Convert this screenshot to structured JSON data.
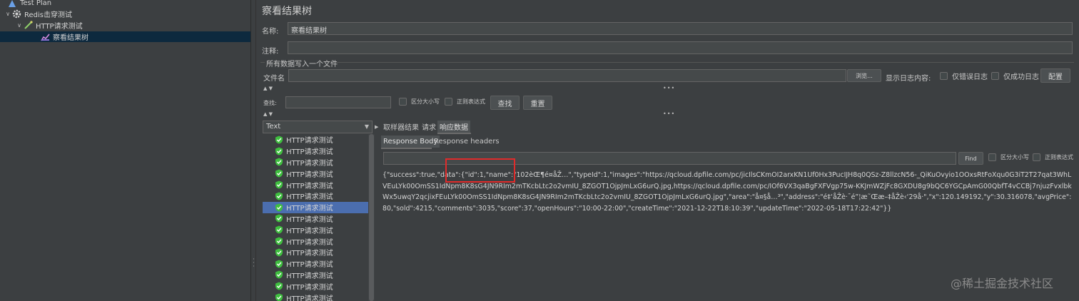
{
  "tree": {
    "items": [
      {
        "label": "Test Plan"
      },
      {
        "label": "Redis击穿测试"
      },
      {
        "label": "HTTP请求测试"
      },
      {
        "label": "察看结果树"
      }
    ]
  },
  "panel": {
    "title": "察看结果树",
    "name_label": "名称:",
    "name_value": "察看结果树",
    "comment_label": "注释:",
    "comment_value": "",
    "section_title": "所有数据写入一个文件",
    "filename_label": "文件名",
    "filename_value": "",
    "browse_label": "浏览...",
    "log_label": "显示日志内容:",
    "errors_only": "仅错误日志",
    "success_only": "仅成功日志",
    "configure_label": "配置"
  },
  "search": {
    "label": "查找:",
    "value": "",
    "case_sensitive": "区分大小写",
    "regex": "正则表达式",
    "find_label": "查找",
    "reset_label": "重置"
  },
  "renderer": {
    "selected": "Text"
  },
  "results": {
    "items": [
      "HTTP请求测试",
      "HTTP请求测试",
      "HTTP请求测试",
      "HTTP请求测试",
      "HTTP请求测试",
      "HTTP请求测试",
      "HTTP请求测试",
      "HTTP请求测试",
      "HTTP请求测试",
      "HTTP请求测试",
      "HTTP请求测试",
      "HTTP请求测试",
      "HTTP请求测试",
      "HTTP请求测试",
      "HTTP请求测试"
    ],
    "selected_index": 6
  },
  "tabs": {
    "sampler_result": "取样器结果",
    "request": "请求",
    "response_data": "响应数据"
  },
  "subtabs": {
    "response_body": "Response Body",
    "response_headers": "Response headers"
  },
  "resp_search": {
    "value": "",
    "find_label": "Find",
    "case_sensitive": "区分大小写",
    "regex": "正则表达式"
  },
  "response": {
    "body": "{\"success\":true,\"data\":{\"id\":1,\"name\":\"102èŒ¶é¤åŽ…\",\"typeId\":1,\"images\":\"https://qcloud.dpfile.com/pc/jicIlsCKmOI2arxKN1Uf0Hx3PucIJH8q0QSz-Z8llzcN56-_QiKuOvyio1OOxsRtFoXqu0G3iT2T27qat3WhLVEuLYk00OmSS1IdNpm8K8sG4JN9RIm2mTKcbLtc2o2vmIU_8ZGOT1OjpJmLxG6urQ.jpg,https://qcloud.dpfile.com/pc/IOf6VX3qaBgFXFVgp75w-KKJmWZjFc8GXDU8g9bQC6YGCpAmG00QbfT4vCCBj7njuzFvxlbkWx5uwqY2qcjixFEuLYk00OmSS1IdNpm8K8sG4JN9RIm2mTKcbLtc2o2vmIU_8ZGOT1OjpJmLxG6urQ.jpg\",\"area\":\"å¤§å…³\",\"address\":\"é‡‘åŽè·¯é”¦æ˜Œæ–‡åŽè‹‘29å·\",\"x\":120.149192,\"y\":30.316078,\"avgPrice\":80,\"sold\":4215,\"comments\":3035,\"score\":37,\"openHours\":\"10:00-22:00\",\"createTime\":\"2021-12-22T18:10:39\",\"updateTime\":\"2022-05-18T17:22:42\"}}"
  },
  "watermark": "@稀土掘金技术社区",
  "colors": {
    "background": "#3c3f41",
    "selection": "#4b6eaf",
    "highlight": "#e02b2b",
    "ok_icon": "#3fbf3f"
  }
}
